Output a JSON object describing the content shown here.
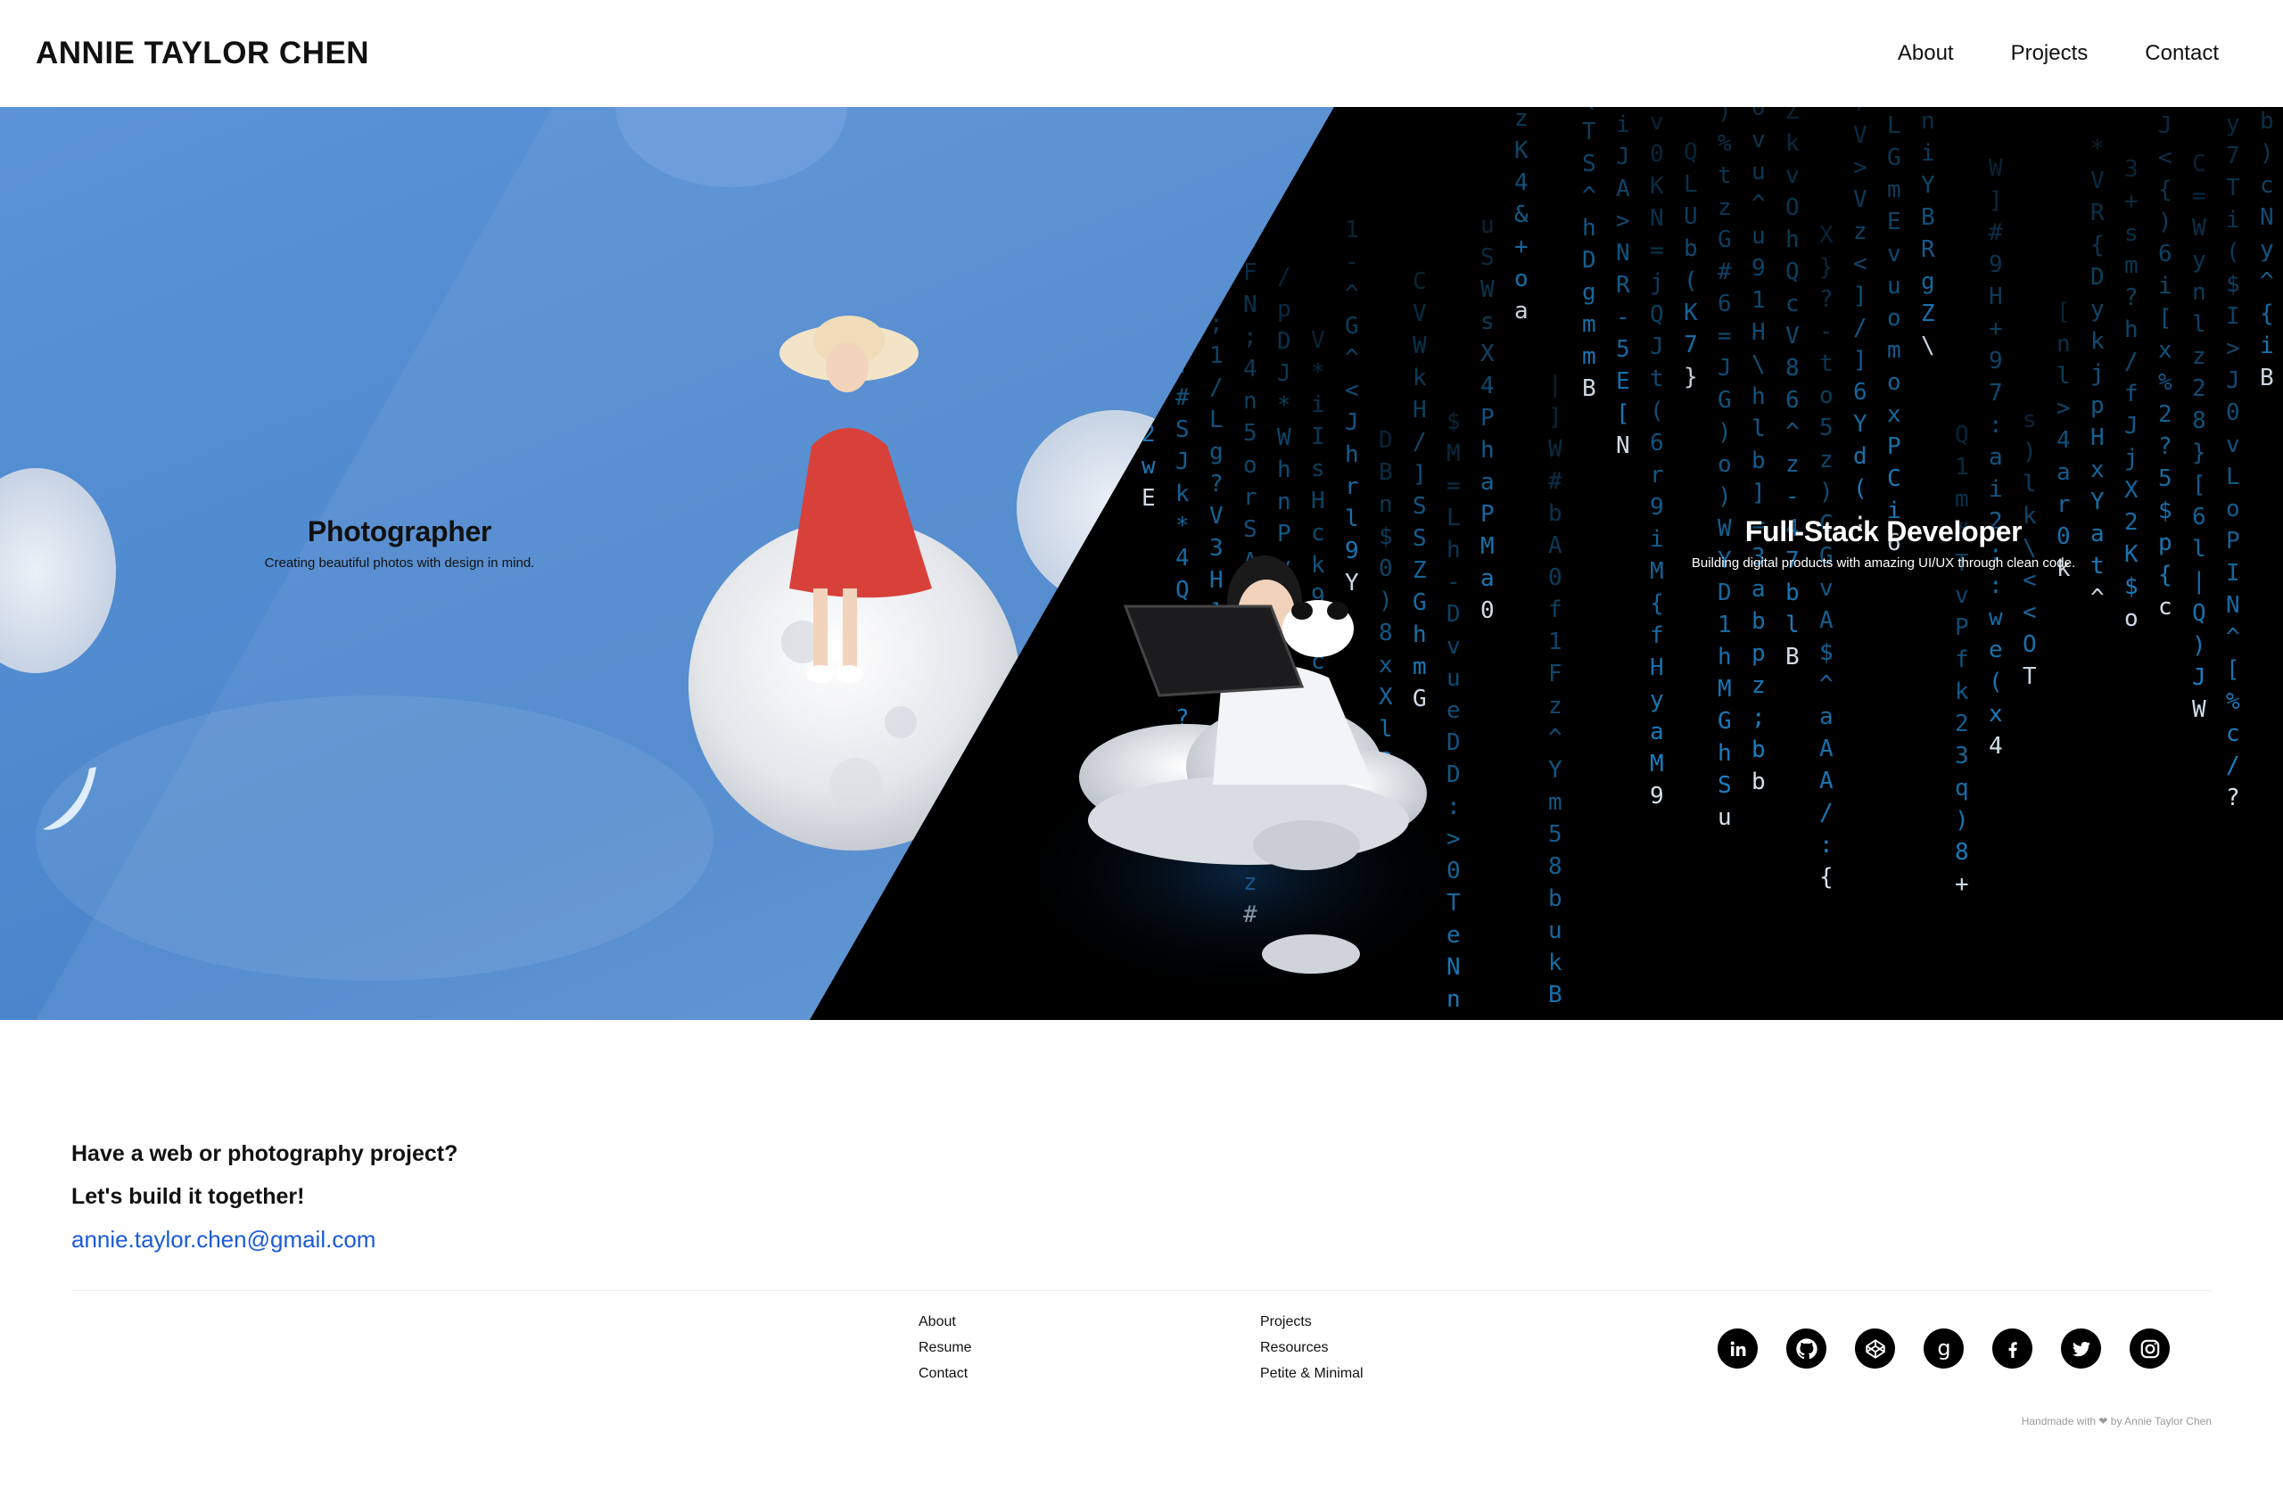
{
  "header": {
    "brand": "ANNIE TAYLOR CHEN",
    "nav": [
      "About",
      "Projects",
      "Contact"
    ]
  },
  "hero": {
    "left": {
      "title": "Photographer",
      "subtitle": "Creating beautiful photos with design in mind."
    },
    "right": {
      "title": "Full-Stack Developer",
      "subtitle": "Building digital products with amazing UI/UX through clean code."
    }
  },
  "contact": {
    "line1": "Have a web or photography project?",
    "line2": "Let's build it together!",
    "email": "annie.taylor.chen@gmail.com"
  },
  "footer": {
    "col1": [
      "About",
      "Resume",
      "Contact"
    ],
    "col2": [
      "Projects",
      "Resources",
      "Petite & Minimal"
    ],
    "social": [
      "linkedin-icon",
      "github-icon",
      "codepen-icon",
      "goodreads-icon",
      "facebook-icon",
      "twitter-icon",
      "instagram-icon"
    ],
    "credit": "Handmade with ❤ by Annie Taylor Chen"
  },
  "colors": {
    "sky": "#4a86cc",
    "matrix": "#000000",
    "link": "#1a5bd6"
  }
}
